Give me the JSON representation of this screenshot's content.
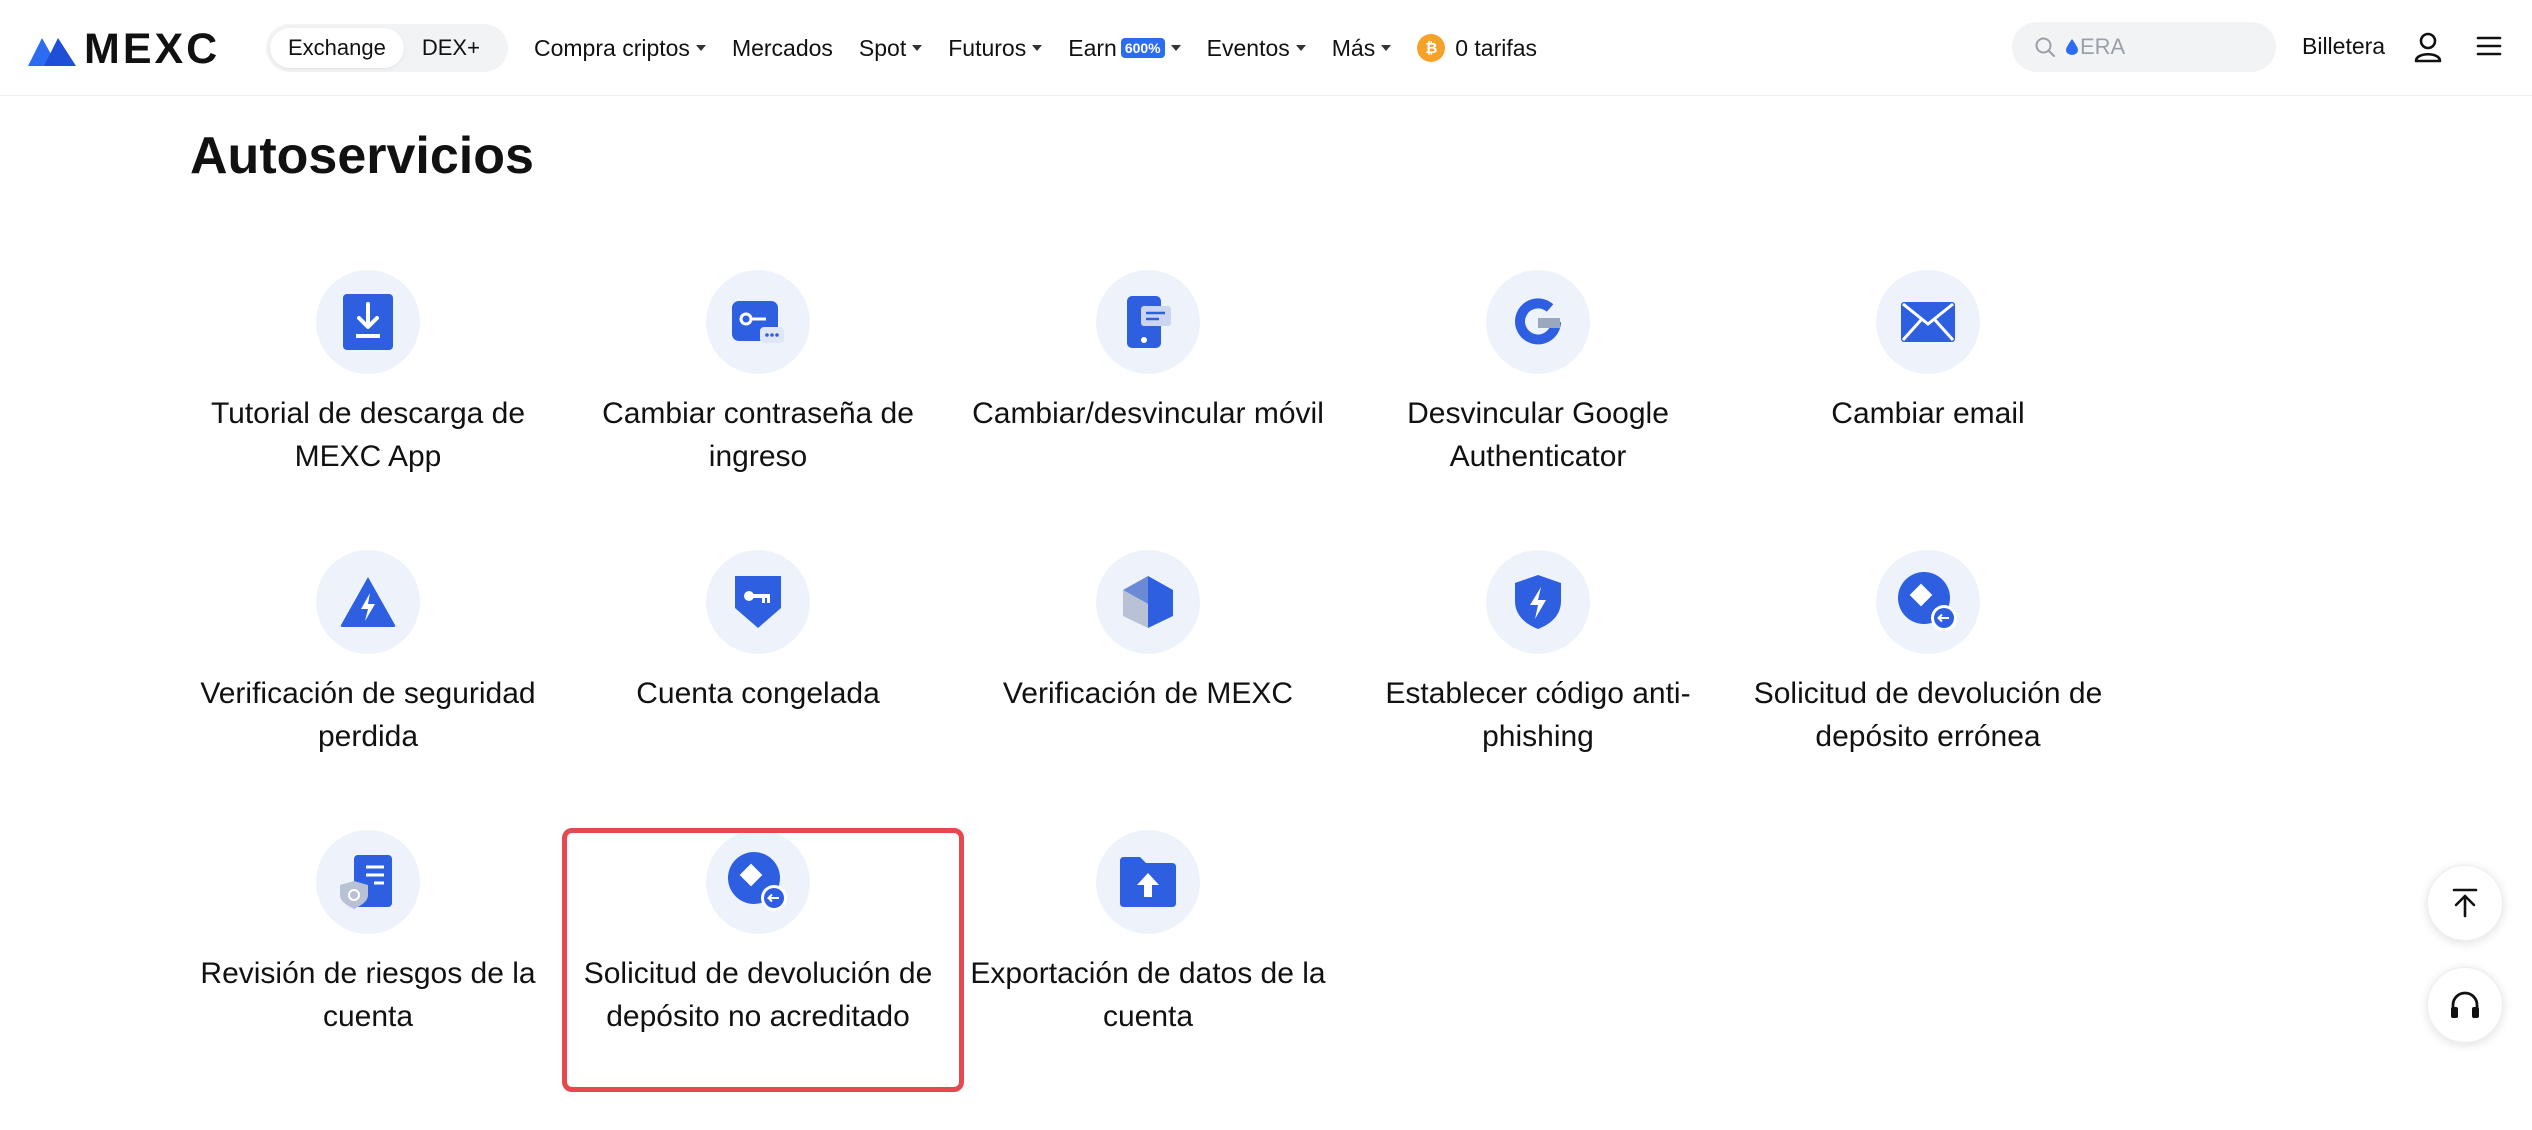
{
  "header": {
    "logo_text": "MEXC",
    "mode_tabs": [
      {
        "label": "Exchange",
        "active": true
      },
      {
        "label": "DEX+",
        "active": false
      }
    ],
    "nav": [
      {
        "label": "Compra criptos",
        "dropdown": true
      },
      {
        "label": "Mercados",
        "dropdown": false
      },
      {
        "label": "Spot",
        "dropdown": true
      },
      {
        "label": "Futuros",
        "dropdown": true
      },
      {
        "label": "Earn",
        "badge": "600%",
        "dropdown": true
      },
      {
        "label": "Eventos",
        "dropdown": true
      },
      {
        "label": "Más",
        "dropdown": true
      }
    ],
    "zero_fees": {
      "coin_symbol": "₿",
      "label": "0 tarifas"
    },
    "search": {
      "placeholder": "ERA"
    },
    "wallet_label": "Billetera",
    "accent_color": "#2b6cf0"
  },
  "main": {
    "title": "Autoservicios",
    "items": [
      {
        "label": "Tutorial de descarga de MEXC App",
        "icon": "download-icon"
      },
      {
        "label": "Cambiar contraseña de ingreso",
        "icon": "password-key-icon"
      },
      {
        "label": "Cambiar/desvincular móvil",
        "icon": "mobile-icon"
      },
      {
        "label": "Desvincular Google Authenticator",
        "icon": "google-icon"
      },
      {
        "label": "Cambiar email",
        "icon": "email-icon"
      },
      {
        "label": "Verificación de seguridad perdida",
        "icon": "lightning-triangle-icon"
      },
      {
        "label": "Cuenta congelada",
        "icon": "frozen-key-shield-icon"
      },
      {
        "label": "Verificación de MEXC",
        "icon": "cube-icon"
      },
      {
        "label": "Establecer código anti-phishing",
        "icon": "shield-lightning-icon"
      },
      {
        "label": "Solicitud de devolución de depósito errónea",
        "icon": "refund-diamond-icon"
      },
      {
        "label": "Revisión de riesgos de la cuenta",
        "icon": "risk-document-icon"
      },
      {
        "label": "Solicitud de devolución de depósito no acreditado",
        "icon": "refund-diamond-icon",
        "selected": true
      },
      {
        "label": "Exportación de datos de la cuenta",
        "icon": "folder-upload-icon"
      }
    ]
  },
  "colors": {
    "icon_blue": "#2d5fe0",
    "icon_bg": "#eef3fb",
    "highlight": "#e5484d"
  }
}
